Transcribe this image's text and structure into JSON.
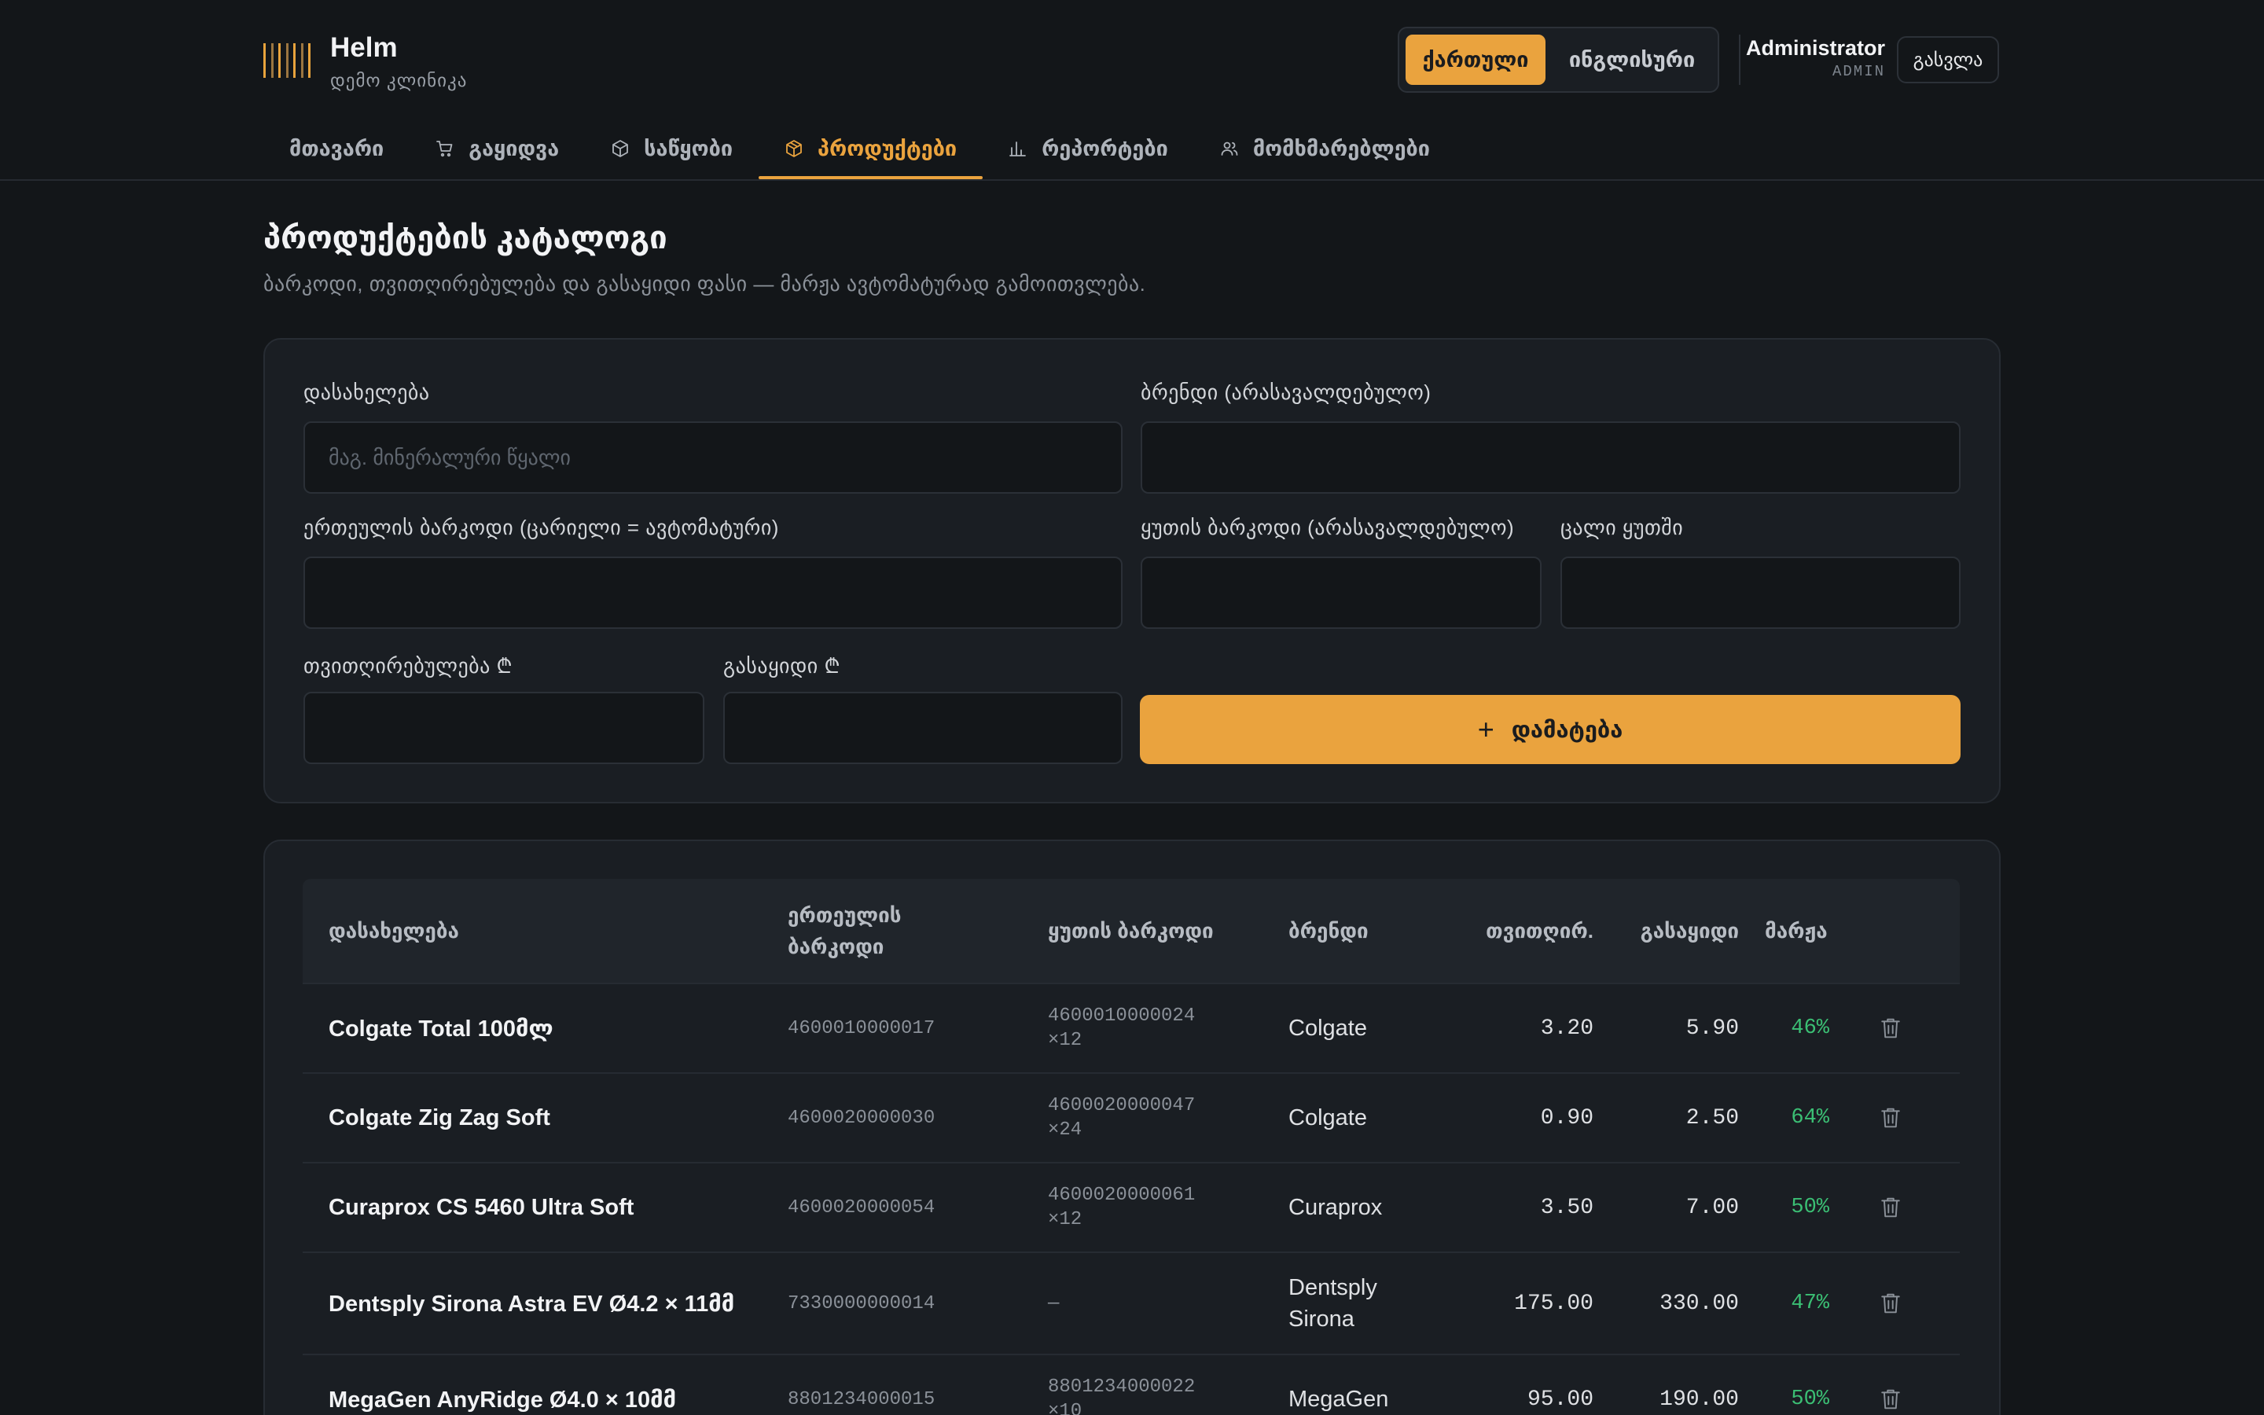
{
  "app": {
    "name": "Helm",
    "subtitle": "დემო კლინიკა"
  },
  "language": {
    "active": "ქართული",
    "other": "ინგლისური"
  },
  "user": {
    "name": "Administrator",
    "role": "ADMIN"
  },
  "logout_label": "გასვლა",
  "nav": [
    {
      "label": "მთავარი",
      "icon": ""
    },
    {
      "label": "გაყიდვა",
      "icon": "cart-icon"
    },
    {
      "label": "საწყობი",
      "icon": "box-icon"
    },
    {
      "label": "პროდუქტები",
      "icon": "package-icon",
      "active": true
    },
    {
      "label": "რეპორტები",
      "icon": "bar-chart-icon"
    },
    {
      "label": "მომხმარებლები",
      "icon": "users-icon"
    }
  ],
  "page": {
    "title": "პროდუქტების კატალოგი",
    "subtitle": "ბარკოდი, თვითღირებულება და გასაყიდი ფასი — მარჟა ავტომატურად გამოითვლება."
  },
  "form": {
    "name_label": "დასახელება",
    "name_placeholder": "მაგ. მინერალური წყალი",
    "brand_label": "ბრენდი (არასავალდებულო)",
    "unit_barcode_label": "ერთეულის ბარკოდი (ცარიელი = ავტომატური)",
    "box_barcode_label": "ყუთის ბარკოდი (არასავალდებულო)",
    "per_box_label": "ცალი ყუთში",
    "cost_label": "თვითღირებულება ₾",
    "price_label": "გასაყიდი ₾",
    "add_label": "დამატება"
  },
  "table": {
    "headers": {
      "name": "დასახელება",
      "unit_barcode_1": "ერთეულის",
      "unit_barcode_2": "ბარკოდი",
      "box_barcode": "ყუთის ბარკოდი",
      "brand": "ბრენდი",
      "cost": "თვითღირ.",
      "price": "გასაყიდი",
      "margin": "მარჟა"
    },
    "rows": [
      {
        "name": "Colgate Total 100მლ",
        "unit_barcode": "4600010000017",
        "box_barcode": "4600010000024",
        "box_qty": "×12",
        "brand": "Colgate",
        "brand_2": "",
        "cost": "3.20",
        "price": "5.90",
        "margin": "46%"
      },
      {
        "name": "Colgate Zig Zag Soft",
        "unit_barcode": "4600020000030",
        "box_barcode": "4600020000047",
        "box_qty": "×24",
        "brand": "Colgate",
        "brand_2": "",
        "cost": "0.90",
        "price": "2.50",
        "margin": "64%"
      },
      {
        "name": "Curaprox CS 5460 Ultra Soft",
        "unit_barcode": "4600020000054",
        "box_barcode": "4600020000061",
        "box_qty": "×12",
        "brand": "Curaprox",
        "brand_2": "",
        "cost": "3.50",
        "price": "7.00",
        "margin": "50%"
      },
      {
        "name": "Dentsply Sirona Astra EV Ø4.2 × 11მმ",
        "unit_barcode": "7330000000014",
        "box_barcode": "—",
        "box_qty": "",
        "brand": "Dentsply",
        "brand_2": "Sirona",
        "cost": "175.00",
        "price": "330.00",
        "margin": "47%"
      },
      {
        "name": "MegaGen AnyRidge Ø4.0 × 10მმ",
        "unit_barcode": "8801234000015",
        "box_barcode": "8801234000022",
        "box_qty": "×10",
        "brand": "MegaGen",
        "brand_2": "",
        "cost": "95.00",
        "price": "190.00",
        "margin": "50%"
      }
    ]
  },
  "colors": {
    "accent": "#eaa33e",
    "margin_positive": "#3bbf74",
    "background": "#131619",
    "card": "#1a1e23"
  }
}
